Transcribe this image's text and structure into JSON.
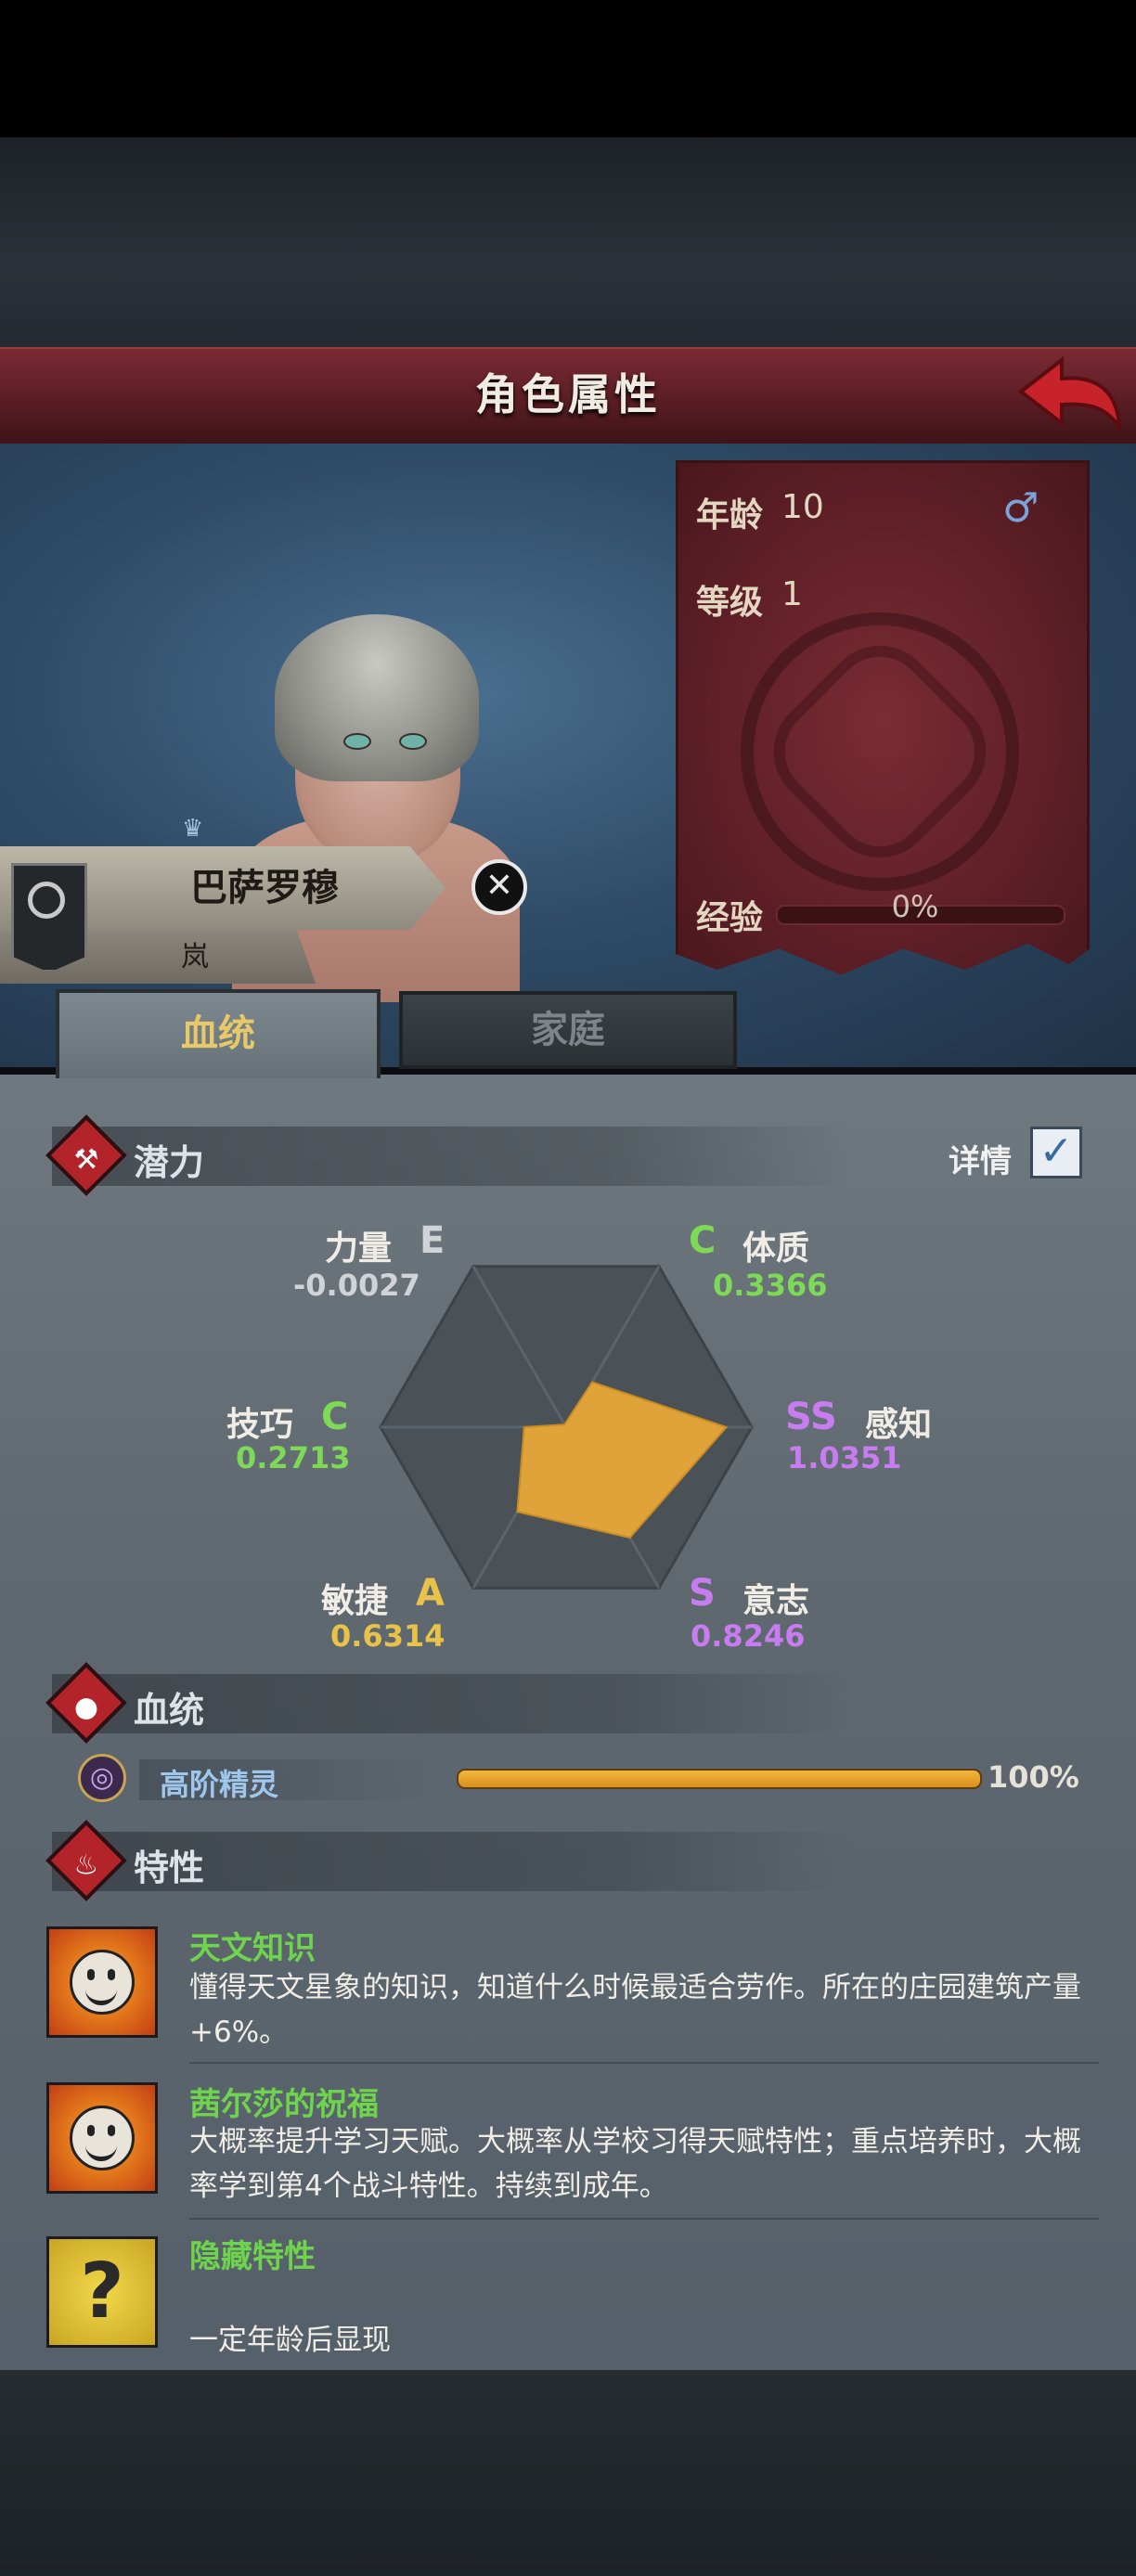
{
  "header": {
    "title": "角色属性"
  },
  "character": {
    "name": "巴萨罗穆",
    "subtitle": "岚"
  },
  "stats": {
    "age_label": "年龄",
    "age_value": "10",
    "gender_icon": "male-icon",
    "gender_glyph": "♂",
    "level_label": "等级",
    "level_value": "1",
    "exp_label": "经验",
    "exp_value": "0%",
    "exp_progress": 0
  },
  "tabs": [
    {
      "label": "血统",
      "active": true
    },
    {
      "label": "家庭",
      "active": false
    }
  ],
  "potential": {
    "title": "潜力",
    "details_label": "详情",
    "details_checked": true,
    "attributes": [
      {
        "name": "力量",
        "grade": "E",
        "value": "-0.0027",
        "num": -0.0027,
        "color": "#d0d4d8"
      },
      {
        "name": "体质",
        "grade": "C",
        "value": "0.3366",
        "num": 0.3366,
        "color": "#7ed957"
      },
      {
        "name": "感知",
        "grade": "SS",
        "value": "1.0351",
        "num": 1.0351,
        "color": "#c77cf0"
      },
      {
        "name": "意志",
        "grade": "S",
        "value": "0.8246",
        "num": 0.8246,
        "color": "#c77cf0"
      },
      {
        "name": "敏捷",
        "grade": "A",
        "value": "0.6314",
        "num": 0.6314,
        "color": "#e9c24a"
      },
      {
        "name": "技巧",
        "grade": "C",
        "value": "0.2713",
        "num": 0.2713,
        "color": "#7ed957"
      }
    ],
    "fill_color": "#e0a339"
  },
  "bloodline": {
    "title": "血统",
    "name": "高阶精灵",
    "percent_label": "100%",
    "percent": 100
  },
  "traits": {
    "title": "特性",
    "items": [
      {
        "name": "天文知识",
        "desc": "懂得天文星象的知识，知道什么时候最适合劳作。所在的庄园建筑产量+6%。",
        "icon": "smile-sun-icon"
      },
      {
        "name": "茜尔莎的祝福",
        "desc": "大概率提升学习天赋。大概率从学校习得天赋特性；重点培养时，大概率学到第4个战斗特性。持续到成年。",
        "icon": "smile-sun-icon"
      },
      {
        "name": "隐藏特性",
        "desc": "一定年龄后显现",
        "icon": "question-mark-icon",
        "glyph": "?"
      }
    ]
  }
}
